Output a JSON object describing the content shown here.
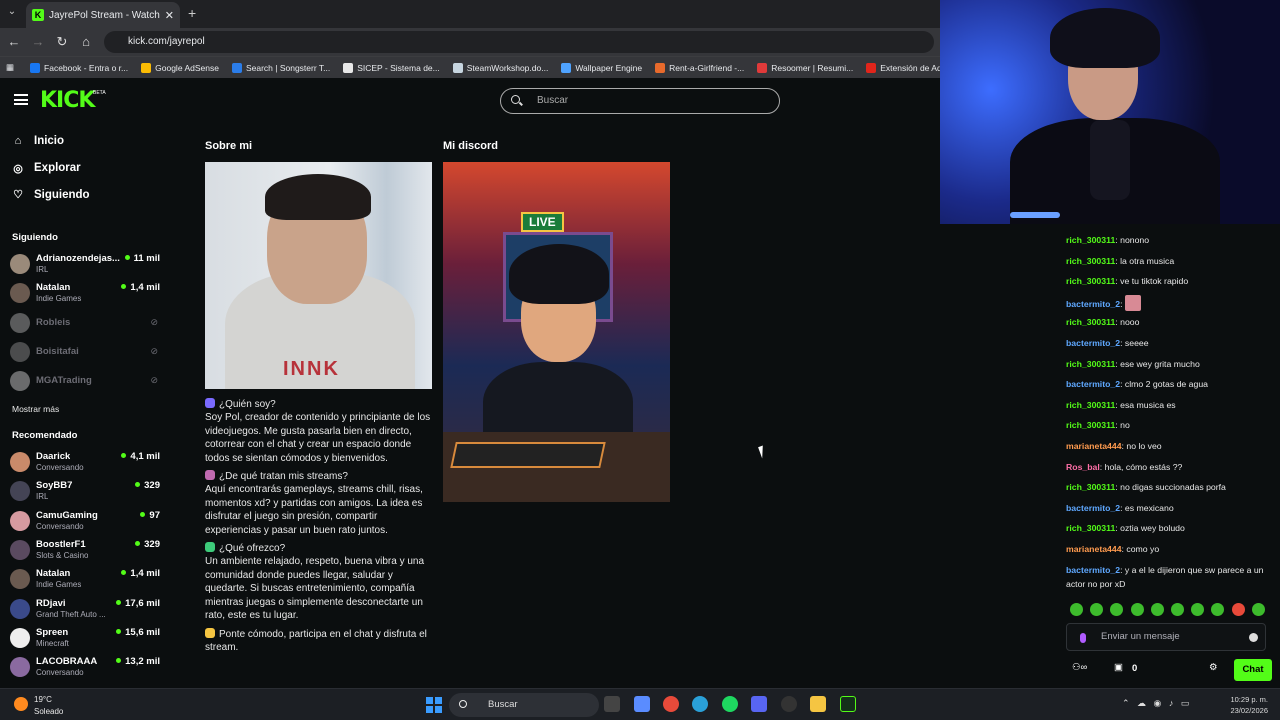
{
  "browser": {
    "tab_title": "JayrePol Stream - Watch Live o",
    "url": "kick.com/jayrepol",
    "bookmarks": [
      {
        "label": "Facebook - Entra o r...",
        "color": "#1877f2"
      },
      {
        "label": "Google AdSense",
        "color": "#fbbc04"
      },
      {
        "label": "Search | Songsterr T...",
        "color": "#2b7de9"
      },
      {
        "label": "SICEP - Sistema de...",
        "color": "#e8e8e8"
      },
      {
        "label": "SteamWorkshop.do...",
        "color": "#c7d5e0"
      },
      {
        "label": "Wallpaper Engine",
        "color": "#4fa3ff"
      },
      {
        "label": "Rent-a-Girlfriend -...",
        "color": "#e86a2c"
      },
      {
        "label": "Resoomer | Resumi...",
        "color": "#e03a3a"
      },
      {
        "label": "Extensión de Adobe...",
        "color": "#e1251b"
      }
    ]
  },
  "header": {
    "logo": "KICK",
    "beta": "BETA",
    "search_placeholder": "Buscar"
  },
  "sidebar": {
    "nav": [
      {
        "label": "Inicio",
        "icon": "home-icon"
      },
      {
        "label": "Explorar",
        "icon": "compass-icon"
      },
      {
        "label": "Siguiendo",
        "icon": "heart-icon"
      }
    ],
    "following_title": "Siguiendo",
    "following": [
      {
        "name": "Adrianozendejas...",
        "category": "IRL",
        "viewers": "11 mil",
        "online": true,
        "color": "#9a8a7a"
      },
      {
        "name": "Natalan",
        "category": "Indie Games",
        "viewers": "1,4 mil",
        "online": true,
        "color": "#6a5a50"
      },
      {
        "name": "Robleis",
        "category": "",
        "viewers": "",
        "online": false,
        "color": "#bbbbbb"
      },
      {
        "name": "Boisitafai",
        "category": "",
        "viewers": "",
        "online": false,
        "color": "#999999"
      },
      {
        "name": "MGATrading",
        "category": "",
        "viewers": "",
        "online": false,
        "color": "#dddddd"
      }
    ],
    "show_more": "Mostrar más",
    "recommended_title": "Recomendado",
    "recommended": [
      {
        "name": "Daarick",
        "category": "Conversando",
        "viewers": "4,1 mil",
        "color": "#c98a6a"
      },
      {
        "name": "SoyBB7",
        "category": "IRL",
        "viewers": "329",
        "color": "#444455"
      },
      {
        "name": "CamuGaming",
        "category": "Conversando",
        "viewers": "97",
        "color": "#d69aa0"
      },
      {
        "name": "BoostlerF1",
        "category": "Slots & Casino",
        "viewers": "329",
        "color": "#5a4a60"
      },
      {
        "name": "Natalan",
        "category": "Indie Games",
        "viewers": "1,4 mil",
        "color": "#6a5a50"
      },
      {
        "name": "RDjavi",
        "category": "Grand Theft Auto ...",
        "viewers": "17,6 mil",
        "color": "#3a4a8a"
      },
      {
        "name": "Spreen",
        "category": "Minecraft",
        "viewers": "15,6 mil",
        "color": "#eeeeee"
      },
      {
        "name": "LACOBRAAA",
        "category": "Conversando",
        "viewers": "13,2 mil",
        "color": "#8a6aa0"
      }
    ]
  },
  "main": {
    "about_title": "Sobre mi",
    "discord_title": "Mi discord",
    "photo_word": "INNK",
    "live_badge": "LIVE",
    "about": [
      {
        "emoji_color": "#7a6aff",
        "text": "¿Quién soy?"
      },
      {
        "emoji_color": "",
        "text": "Soy Pol, creador de contenido y principiante de los videojuegos. Me gusta pasarla bien en directo, cotorrear con el chat y crear un espacio donde todos se sientan cómodos y bienvenidos."
      },
      {
        "emoji_color": "#c06ab0",
        "text": "¿De qué tratan mis streams?"
      },
      {
        "emoji_color": "",
        "text": "Aquí encontrarás gameplays, streams chill, risas, momentos xd? y partidas con amigos. La idea es disfrutar el juego sin presión, compartir experiencias y pasar un buen rato juntos."
      },
      {
        "emoji_color": "#3dcb7a",
        "text": "¿Qué ofrezco?"
      },
      {
        "emoji_color": "",
        "text": "Un ambiente relajado, respeto, buena vibra y una comunidad donde puedes llegar, saludar y quedarte. Si buscas entretenimiento, compañía mientras juegas o simplemente desconectarte un rato, este es tu lugar."
      },
      {
        "emoji_color": "#f5c542",
        "text": "Ponte cómodo, participa en el chat y disfruta el stream."
      }
    ]
  },
  "chat": {
    "messages": [
      {
        "user": "rich_300311",
        "color": "g",
        "text": "nonono"
      },
      {
        "user": "rich_300311",
        "color": "g",
        "text": "la otra musica"
      },
      {
        "user": "rich_300311",
        "color": "g",
        "text": "ve tu tiktok rapido"
      },
      {
        "user": "bactermito_2",
        "color": "b",
        "text": "",
        "sticker": true
      },
      {
        "user": "rich_300311",
        "color": "g",
        "text": "nooo"
      },
      {
        "user": "bactermito_2",
        "color": "b",
        "text": "seeee"
      },
      {
        "user": "rich_300311",
        "color": "g",
        "text": "ese wey grita mucho"
      },
      {
        "user": "bactermito_2",
        "color": "b",
        "text": "clmo 2 gotas de agua"
      },
      {
        "user": "rich_300311",
        "color": "g",
        "text": "esa musica es"
      },
      {
        "user": "rich_300311",
        "color": "g",
        "text": "no"
      },
      {
        "user": "marianeta444",
        "color": "o",
        "text": "no lo veo"
      },
      {
        "user": "Ros_bal",
        "color": "p",
        "text": "hola, cómo estás ??"
      },
      {
        "user": "rich_300311",
        "color": "g",
        "text": "no digas succionadas porfa"
      },
      {
        "user": "bactermito_2",
        "color": "b",
        "text": "es mexicano"
      },
      {
        "user": "rich_300311",
        "color": "g",
        "text": "oztia wey boludo"
      },
      {
        "user": "marianeta444",
        "color": "o",
        "text": "como yo"
      },
      {
        "user": "bactermito_2",
        "color": "b",
        "text": "y a el le dijieron que sw parece a un actor no por xD"
      }
    ],
    "input_placeholder": "Enviar un mensaje",
    "count": "0",
    "send_label": "Chat"
  },
  "taskbar": {
    "temp": "19°C",
    "weather": "Soleado",
    "search": "Buscar",
    "time": "10:29 p. m.",
    "date": "23/02/2026"
  }
}
